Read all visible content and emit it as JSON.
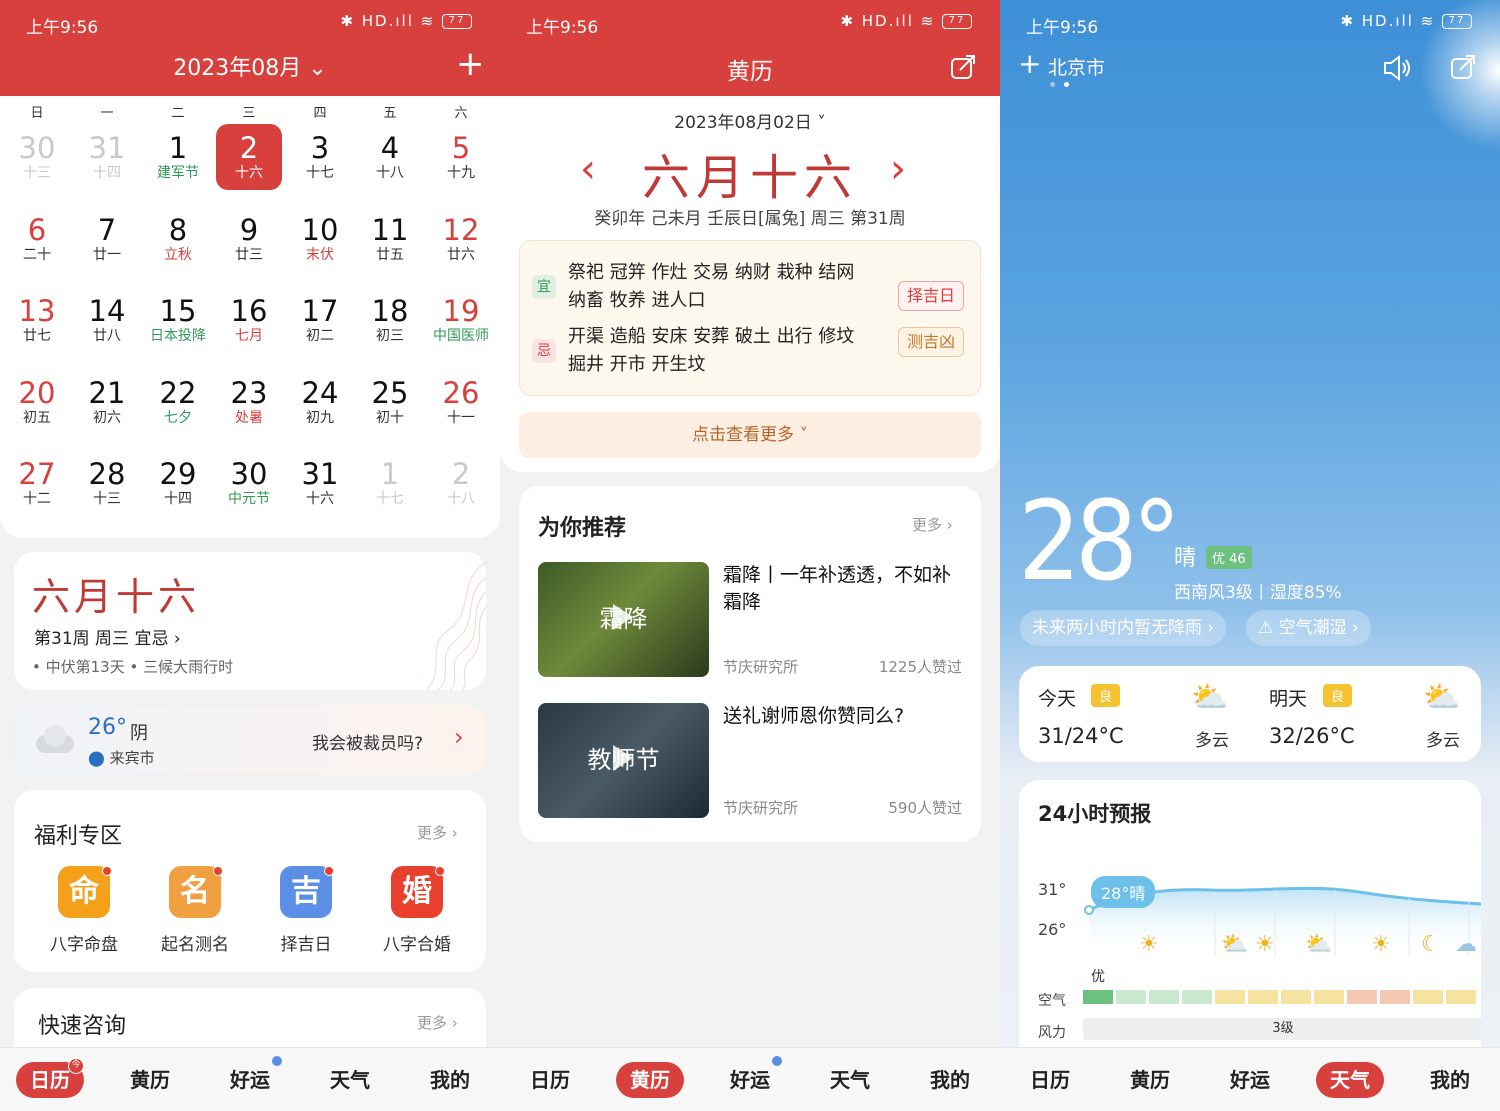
{
  "status": {
    "time": "上午9:56",
    "battery": "77",
    "signal": "✱ HD.ıll ≋"
  },
  "panel1": {
    "header_month": "2023年08月",
    "weekdays": [
      "日",
      "一",
      "二",
      "三",
      "四",
      "五",
      "六"
    ],
    "weeks": [
      [
        {
          "n": "30",
          "l": "十三",
          "t": "grey"
        },
        {
          "n": "31",
          "l": "十四",
          "t": "grey"
        },
        {
          "n": "1",
          "l": "建军节",
          "t": "",
          "lt": "green"
        },
        {
          "n": "2",
          "l": "十六",
          "t": "sel"
        },
        {
          "n": "3",
          "l": "十七",
          "t": ""
        },
        {
          "n": "4",
          "l": "十八",
          "t": ""
        },
        {
          "n": "5",
          "l": "十九",
          "t": "red"
        }
      ],
      [
        {
          "n": "6",
          "l": "二十",
          "t": "red"
        },
        {
          "n": "7",
          "l": "廿一",
          "t": ""
        },
        {
          "n": "8",
          "l": "立秋",
          "t": "",
          "lt": "redl"
        },
        {
          "n": "9",
          "l": "廿三",
          "t": ""
        },
        {
          "n": "10",
          "l": "末伏",
          "t": "",
          "lt": "redl"
        },
        {
          "n": "11",
          "l": "廿五",
          "t": ""
        },
        {
          "n": "12",
          "l": "廿六",
          "t": "red"
        }
      ],
      [
        {
          "n": "13",
          "l": "廿七",
          "t": "red"
        },
        {
          "n": "14",
          "l": "廿八",
          "t": ""
        },
        {
          "n": "15",
          "l": "日本投降",
          "t": "",
          "lt": "green"
        },
        {
          "n": "16",
          "l": "七月",
          "t": "",
          "lt": "redl"
        },
        {
          "n": "17",
          "l": "初二",
          "t": ""
        },
        {
          "n": "18",
          "l": "初三",
          "t": ""
        },
        {
          "n": "19",
          "l": "中国医师",
          "t": "red",
          "lt": "green"
        }
      ],
      [
        {
          "n": "20",
          "l": "初五",
          "t": "red"
        },
        {
          "n": "21",
          "l": "初六",
          "t": ""
        },
        {
          "n": "22",
          "l": "七夕",
          "t": "",
          "lt": "green"
        },
        {
          "n": "23",
          "l": "处暑",
          "t": "",
          "lt": "redl"
        },
        {
          "n": "24",
          "l": "初九",
          "t": ""
        },
        {
          "n": "25",
          "l": "初十",
          "t": ""
        },
        {
          "n": "26",
          "l": "十一",
          "t": "red"
        }
      ],
      [
        {
          "n": "27",
          "l": "十二",
          "t": "red"
        },
        {
          "n": "28",
          "l": "十三",
          "t": ""
        },
        {
          "n": "29",
          "l": "十四",
          "t": ""
        },
        {
          "n": "30",
          "l": "中元节",
          "t": "",
          "lt": "green"
        },
        {
          "n": "31",
          "l": "十六",
          "t": ""
        },
        {
          "n": "1",
          "l": "十七",
          "t": "grey"
        },
        {
          "n": "2",
          "l": "十八",
          "t": "grey"
        }
      ]
    ],
    "lunar_big": "六月十六",
    "week_info": "第31周 周三 宜忌 ›",
    "notes": "• 中伏第13天  • 三候大雨行时",
    "weather_temp": "26°",
    "weather_cond": "阴",
    "weather_city": "来宾市",
    "weather_question": "我会被裁员吗?",
    "welfare_title": "福利专区",
    "more": "更多 ›",
    "tiles": [
      {
        "char": "命",
        "label": "八字命盘",
        "color": "#f5a01a"
      },
      {
        "char": "名",
        "label": "起名测名",
        "color": "#f0a040"
      },
      {
        "char": "吉",
        "label": "择吉日",
        "color": "#5b8fe6"
      },
      {
        "char": "婚",
        "label": "八字合婚",
        "color": "#e8402d"
      }
    ],
    "consult_title": "快速咨询"
  },
  "panel2": {
    "title": "黄历",
    "date": "2023年08月02日 ˅",
    "lunar": "六月十六",
    "ganzhi": "癸卯年 己未月 壬辰日[属兔] 周三 第31周",
    "yi_tag": "宜",
    "yi_text": "祭祀 冠笄 作灶 交易 纳财 栽种 结网 纳畜 牧养 进人口",
    "ji_tag": "忌",
    "ji_text": "开渠 造船 安床 安葬 破土 出行 修坟 掘井 开市 开生坟",
    "btn_zeji": "择吉日",
    "btn_ceji": "测吉凶",
    "see_more": "点击查看更多 ˅",
    "rec_title": "为你推荐",
    "more": "更多 ›",
    "articles": [
      {
        "title": "霜降丨一年补透透，不如补霜降",
        "source": "节庆研究所",
        "likes": "1225人赞过",
        "thumb": "霜降"
      },
      {
        "title": "送礼谢师恩你赞同么?",
        "source": "节庆研究所",
        "likes": "590人赞过",
        "thumb": "教师节"
      }
    ]
  },
  "panel3": {
    "city": "北京市",
    "temp": "28°",
    "cond": "晴",
    "aqi": "优 46",
    "wind": "西南风3级丨湿度85%",
    "pill1": "未来两小时内暂无降雨 ›",
    "pill2": "⚠ 空气潮湿 ›",
    "today_label": "今天",
    "today_q": "良",
    "today_range": "31/24°C",
    "today_cond": "多云",
    "tomorrow_label": "明天",
    "tomorrow_q": "良",
    "tomorrow_range": "32/26°C",
    "tomorrow_cond": "多云",
    "forecast_title": "24小时预报",
    "t_high": "31°",
    "t_low": "26°",
    "now_bubble": "28°晴",
    "aq_label": "空气",
    "aq_first": "优",
    "wind_label": "风力",
    "wind_level": "3级",
    "aq_colors": [
      "#6cc17e",
      "#c8e8cf",
      "#c8e8cf",
      "#c8e8cf",
      "#f7e3a0",
      "#f7e3a0",
      "#f7e3a0",
      "#f7e3a0",
      "#f5c8b4",
      "#f5c8b4",
      "#f7e3a0",
      "#f7e3a0"
    ],
    "hour_icons": [
      "☀",
      "⛅",
      "☀",
      "⛅",
      "☀",
      "☾",
      "☁"
    ]
  },
  "tabs": [
    "日历",
    "黄历",
    "好运",
    "天气",
    "我的"
  ],
  "colors": {
    "accent": "#d8403e",
    "green": "#2f9a56",
    "blue": "#5b8fe6"
  }
}
